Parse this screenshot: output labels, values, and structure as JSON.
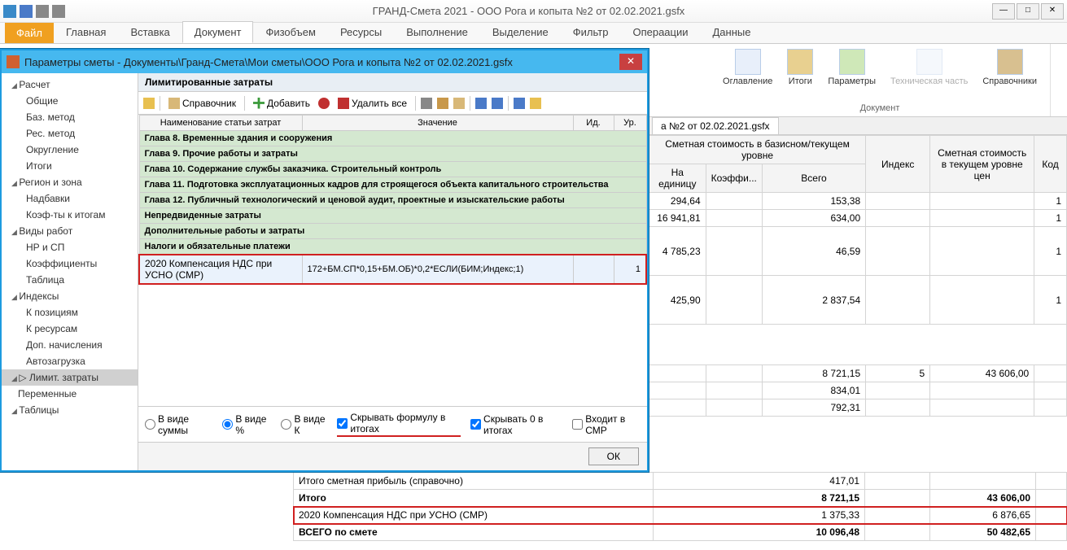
{
  "window": {
    "title": "ГРАНД-Смета 2021 - ООО Рога и копыта №2 от 02.02.2021.gsfx"
  },
  "ribbon": {
    "file": "Файл",
    "tabs": [
      "Главная",
      "Вставка",
      "Документ",
      "Физобъем",
      "Ресурсы",
      "Выполнение",
      "Выделение",
      "Фильтр",
      "Операации",
      "Данные"
    ],
    "active_tab": "Документ",
    "group_right": {
      "buttons": [
        {
          "label": "Оглавление"
        },
        {
          "label": "Итоги"
        },
        {
          "label": "Параметры"
        },
        {
          "label": "Техническая часть",
          "disabled": true
        },
        {
          "label": "Справочники"
        }
      ],
      "group_label": "Документ"
    }
  },
  "doc_tab": "а №2 от 02.02.2021.gsfx",
  "left_tree": {
    "groups": [
      {
        "label": "Расчет",
        "items": [
          "Общие",
          "Баз. метод",
          "Рес. метод",
          "Округление",
          "Итоги"
        ]
      },
      {
        "label": "Регион и зона",
        "items": [
          "Надбавки",
          "Коэф-ты к итогам"
        ]
      },
      {
        "label": "Виды работ",
        "items": [
          "НР и СП",
          "Коэффициенты",
          "Таблица"
        ]
      },
      {
        "label": "Индексы",
        "items": [
          "К позициям",
          "К ресурсам",
          "Доп. начисления",
          "Автозагрузка"
        ]
      },
      {
        "label": "Лимит. затраты",
        "selected": true,
        "items": []
      },
      {
        "label": "Переменные",
        "noexpand": true
      },
      {
        "label": "Таблицы",
        "noexpand": true
      }
    ]
  },
  "modal": {
    "title": "Параметры сметы - Документы\\Гранд-Смета\\Мои сметы\\ООО Рога и копыта №2 от 02.02.2021.gsfx",
    "section_header": "Лимитированные затраты",
    "toolbar": {
      "ref": "Справочник",
      "add": "Добавить",
      "del_all": "Удалить все"
    },
    "columns": [
      "Наименование статьи затрат",
      "Значение",
      "Ид.",
      "Ур."
    ],
    "chapters": [
      "Глава 8. Временные здания и сооружения",
      "Глава 9. Прочие работы и затраты",
      "Глава 10. Содержание службы заказчика. Строительный контроль",
      "Глава 11. Подготовка эксплуатационных кадров для строящегося объекта капитального строительства",
      "Глава 12. Публичный технологический и ценовой аудит, проектные и изыскательские работы",
      "Непредвиденные затраты",
      "Дополнительные работы и затраты",
      "Налоги и обязательные платежи"
    ],
    "selected_row": {
      "code": "2020",
      "name": "Компенсация НДС при УСНО (СМР)",
      "value": "172+БМ.СП*0,15+БМ.ОБ)*0,2*ЕСЛИ(БИМ;Индекс;1)",
      "id": "",
      "ur": "1"
    },
    "footer": {
      "r_sum": "В виде суммы",
      "r_pct": "В виде %",
      "r_k": "В виде К",
      "c_hide_formula": "Скрывать формулу в итогах",
      "c_hide_zero": "Скрывать 0 в итогах",
      "c_in_smr": "Входит в СМР",
      "ok": "ОК"
    }
  },
  "bg_grid": {
    "headers": {
      "h1": "Сметная стоимость в базисном/текущем уровне",
      "h2": "Индекс",
      "h3": "Сметная стоимость в текущем уровне цен",
      "h4": "Код",
      "sub1": "На единицу",
      "sub2": "Коэффи...",
      "sub3": "Всего"
    },
    "rows": [
      {
        "unit": "294,64",
        "k": "",
        "total": "153,38",
        "idx": "",
        "cur": "",
        "code": "1"
      },
      {
        "unit": "16 941,81",
        "k": "",
        "total": "634,00",
        "idx": "",
        "cur": "",
        "code": "1"
      },
      {
        "unit": "4 785,23",
        "k": "",
        "total": "46,59",
        "idx": "",
        "cur": "",
        "code": "1"
      },
      {
        "unit": "425,90",
        "k": "",
        "total": "2 837,54",
        "idx": "",
        "cur": "",
        "code": "1"
      }
    ],
    "bottom": [
      {
        "label": "",
        "total": "8 721,15",
        "idx": "5",
        "cur": "43 606,00"
      },
      {
        "label": "",
        "total": "834,01",
        "idx": "",
        "cur": ""
      },
      {
        "label": "",
        "total": "792,31",
        "idx": "",
        "cur": ""
      },
      {
        "label": "Итого сметная прибыль (справочно)",
        "total": "417,01",
        "idx": "",
        "cur": ""
      },
      {
        "label": "Итого",
        "total": "8 721,15",
        "idx": "",
        "cur": "43 606,00",
        "bold": true
      },
      {
        "label": "2020 Компенсация НДС при УСНО (СМР)",
        "total": "1 375,33",
        "idx": "",
        "cur": "6 876,65",
        "hl": true
      },
      {
        "label": "ВСЕГО по смете",
        "total": "10 096,48",
        "idx": "",
        "cur": "50 482,65",
        "bold": true
      }
    ]
  }
}
